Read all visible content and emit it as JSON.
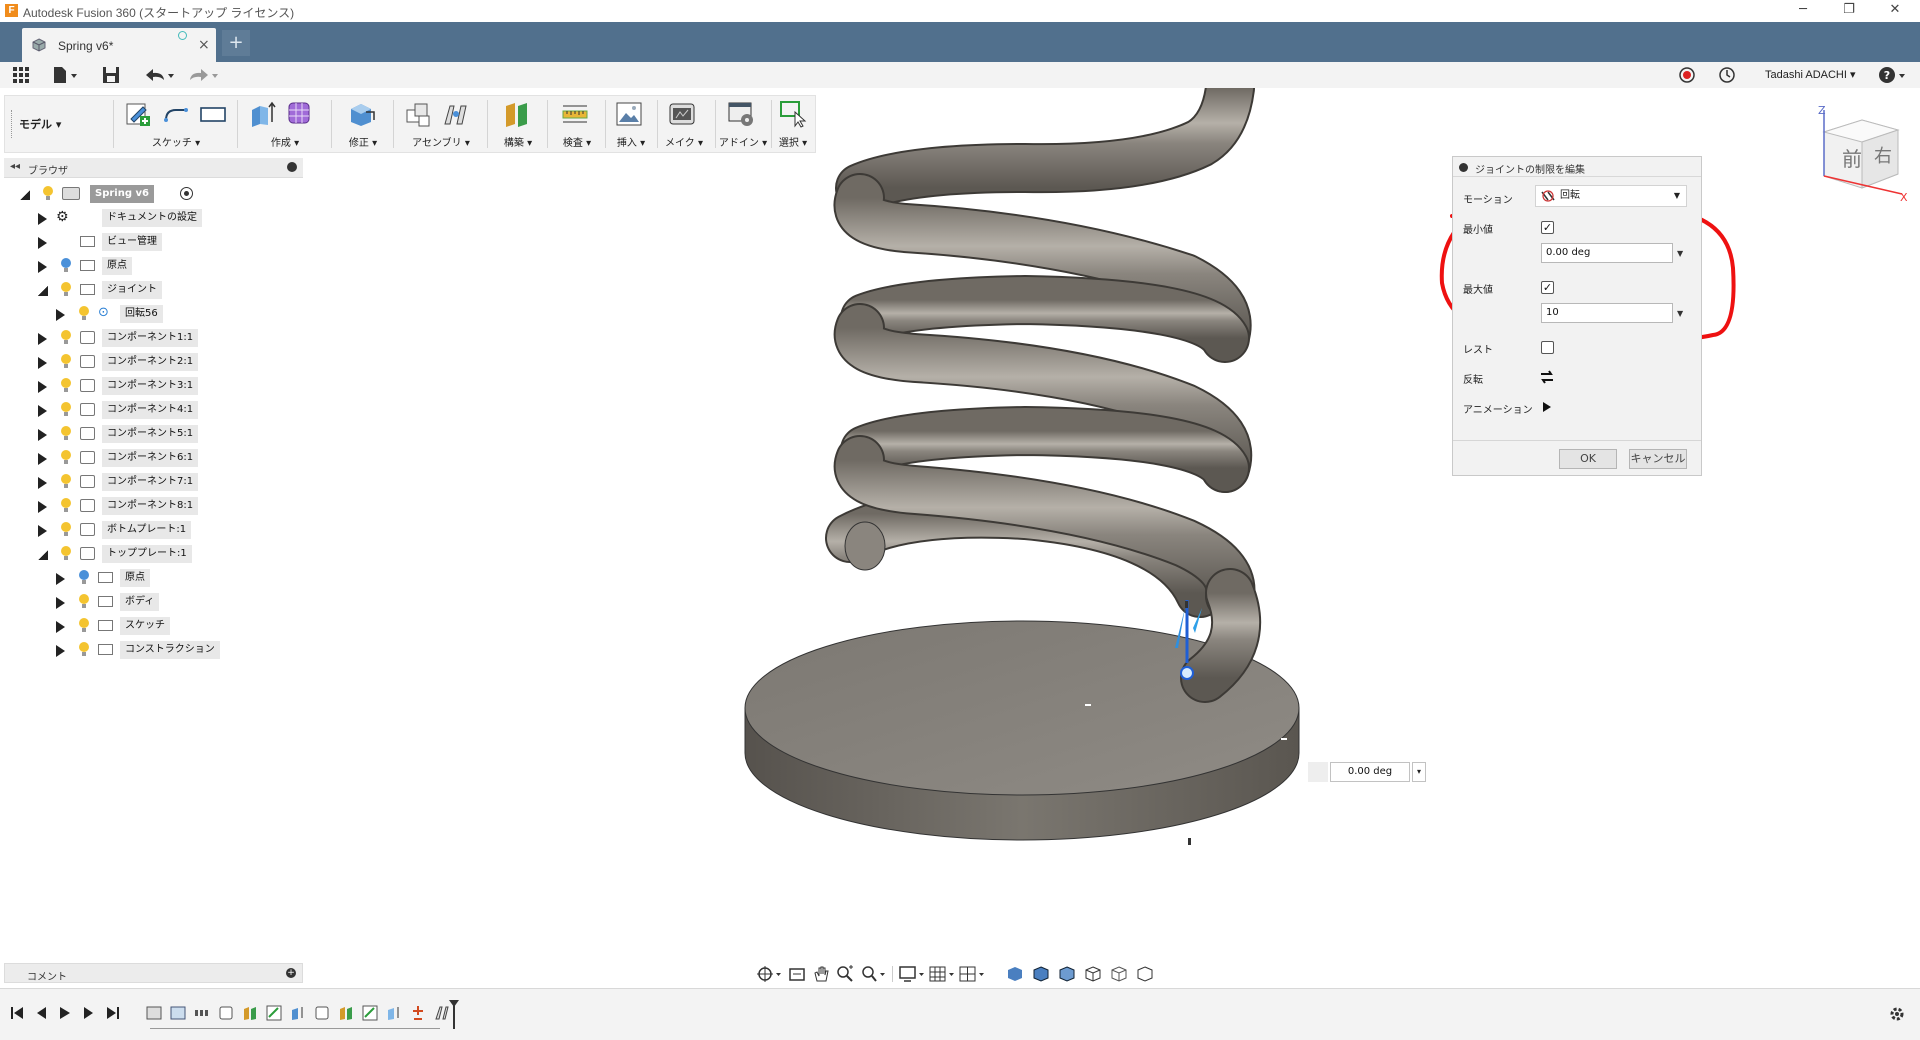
{
  "window": {
    "title": "Autodesk Fusion 360 (スタートアップ ライセンス)",
    "app_logo": "F"
  },
  "tabs": {
    "active": "Spring v6*",
    "close_glyph": "×",
    "new_glyph": "+"
  },
  "quick_access": {
    "user": "Tadashi ADACHI ▾"
  },
  "toolbar": {
    "workspace": "モデル ▾",
    "groups": [
      {
        "label": "スケッチ ▾",
        "icons": [
          "create-sketch-icon",
          "line-icon",
          "rectangle-icon"
        ]
      },
      {
        "label": "作成 ▾",
        "icons": [
          "extrude-icon",
          "form-icon"
        ]
      },
      {
        "label": "修正 ▾",
        "icons": [
          "press-pull-icon"
        ]
      },
      {
        "label": "アセンブリ ▾",
        "icons": [
          "new-component-icon",
          "joint-icon"
        ]
      },
      {
        "label": "構築 ▾",
        "icons": [
          "offset-plane-icon"
        ]
      },
      {
        "label": "検査 ▾",
        "icons": [
          "measure-icon"
        ]
      },
      {
        "label": "挿入 ▾",
        "icons": [
          "insert-image-icon"
        ]
      },
      {
        "label": "メイク ▾",
        "icons": [
          "make-icon"
        ]
      },
      {
        "label": "アドイン ▾",
        "icons": [
          "scripts-icon"
        ]
      },
      {
        "label": "選択 ▾",
        "icons": [
          "select-icon"
        ]
      }
    ]
  },
  "browser": {
    "title": "ブラウザ",
    "root": "Spring v6",
    "nodes": [
      {
        "label": "ドキュメントの設定",
        "depth": 1,
        "icon": "gear-icon",
        "open": false
      },
      {
        "label": "ビュー管理",
        "depth": 1,
        "icon": "folder-icon",
        "open": false
      },
      {
        "label": "原点",
        "depth": 1,
        "icon": "folder-icon",
        "open": false
      },
      {
        "label": "ジョイント",
        "depth": 1,
        "icon": "folder-icon",
        "open": true
      },
      {
        "label": "回転56",
        "depth": 2,
        "icon": "joint-icon",
        "open": false
      },
      {
        "label": "コンポーネント1:1",
        "depth": 1,
        "icon": "component-icon",
        "open": false
      },
      {
        "label": "コンポーネント2:1",
        "depth": 1,
        "icon": "component-icon",
        "open": false
      },
      {
        "label": "コンポーネント3:1",
        "depth": 1,
        "icon": "component-icon",
        "open": false
      },
      {
        "label": "コンポーネント4:1",
        "depth": 1,
        "icon": "component-icon",
        "open": false
      },
      {
        "label": "コンポーネント5:1",
        "depth": 1,
        "icon": "component-icon",
        "open": false
      },
      {
        "label": "コンポーネント6:1",
        "depth": 1,
        "icon": "component-icon",
        "open": false
      },
      {
        "label": "コンポーネント7:1",
        "depth": 1,
        "icon": "component-icon",
        "open": false
      },
      {
        "label": "コンポーネント8:1",
        "depth": 1,
        "icon": "component-icon",
        "open": false
      },
      {
        "label": "ボトムプレート:1",
        "depth": 1,
        "icon": "component-icon",
        "open": false
      },
      {
        "label": "トッププレート:1",
        "depth": 1,
        "icon": "component-icon",
        "open": true
      },
      {
        "label": "原点",
        "depth": 2,
        "icon": "folder-icon",
        "open": false
      },
      {
        "label": "ボディ",
        "depth": 2,
        "icon": "folder-icon",
        "open": false
      },
      {
        "label": "スケッチ",
        "depth": 2,
        "icon": "folder-icon",
        "open": false
      },
      {
        "label": "コンストラクション",
        "depth": 2,
        "icon": "folder-icon",
        "open": false
      }
    ]
  },
  "comments": {
    "label": "コメント"
  },
  "dialog": {
    "title": "ジョイントの制限を編集",
    "motion_label": "モーション",
    "motion_value": "回転",
    "min_label": "最小値",
    "min_checked": true,
    "min_value": "0.00 deg",
    "max_label": "最大値",
    "max_checked": true,
    "max_value": "10",
    "rest_label": "レスト",
    "rest_checked": false,
    "flip_label": "反転",
    "animation_label": "アニメーション",
    "ok_label": "OK",
    "cancel_label": "キャンセル",
    "check_glyph": "✓"
  },
  "canvas": {
    "angle_value": "0.00 deg",
    "annotation_color": "#ee1111",
    "viewcube": {
      "front": "前",
      "right": "右",
      "axis_z": "Z",
      "axis_x": "X"
    }
  },
  "colors": {
    "tabbar": "#51708d",
    "spring": "#7f7a73",
    "plate": "#86827c"
  }
}
